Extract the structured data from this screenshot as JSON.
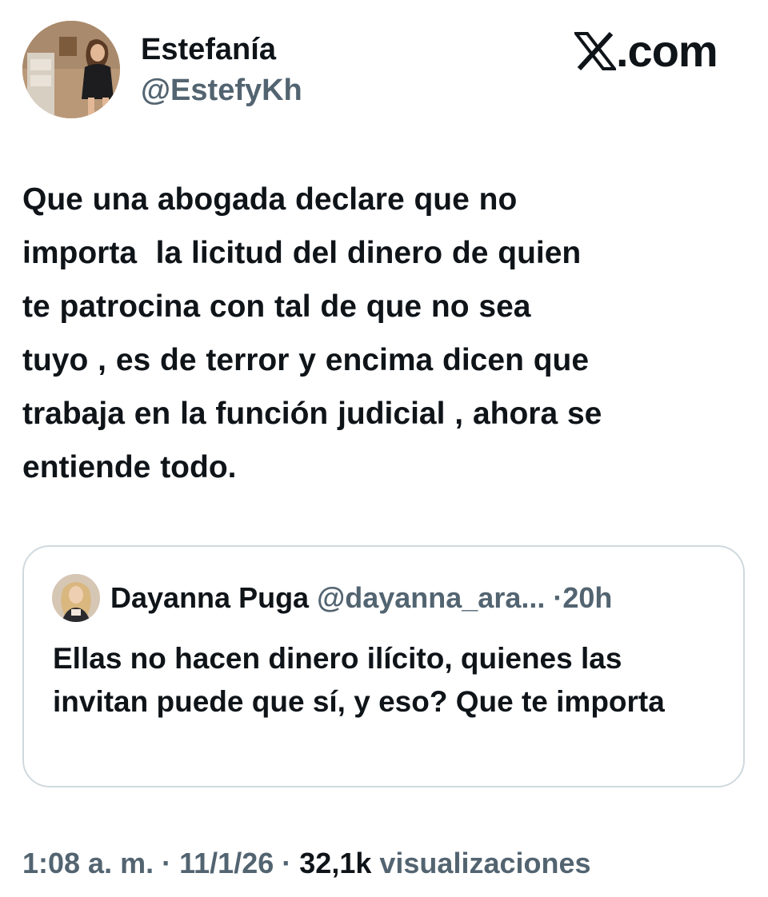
{
  "author": {
    "name": "Estefanía",
    "handle": "@EstefyKh"
  },
  "brand": {
    "text": ".com",
    "icon": "x-logo-icon"
  },
  "tweet": {
    "text": "Que una abogada declare que no\nimporta  la licitud del dinero de quien\nte patrocina con tal de que no sea\ntuyo , es de terror y encima dicen que\ntrabaja en la función judicial , ahora se\nentiende todo."
  },
  "quoted_tweet": {
    "name": "Dayanna Puga",
    "handle": "@dayanna_ara...",
    "separator": "·",
    "time": "20h",
    "text": "Ellas no hacen dinero ilícito, quienes las invitan puede que sí, y eso? Que te importa"
  },
  "meta": {
    "time": "1:08 a. m.",
    "sep1": "·",
    "date": "11/1/26",
    "sep2": "·",
    "views": "32,1k",
    "views_label": "visualizaciones"
  },
  "colors": {
    "text": "#0f1419",
    "secondary": "#536471",
    "border": "#cfd9de"
  }
}
